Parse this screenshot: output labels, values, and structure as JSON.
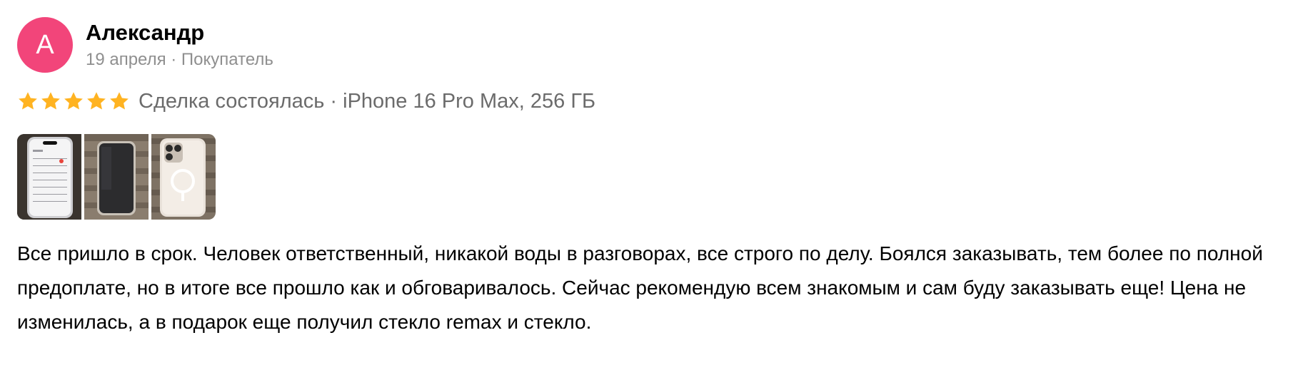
{
  "author": {
    "initial": "А",
    "name": "Александр",
    "meta": "19 апреля · Покупатель",
    "avatar_color": "#f2457a"
  },
  "rating": {
    "stars": 5,
    "star_color": "#ffb321",
    "deal_text": "Сделка состоялась · iPhone 16 Pro Max, 256 ГБ"
  },
  "photos": [
    {
      "name": "photo-phone-screen"
    },
    {
      "name": "photo-phone-back-dark"
    },
    {
      "name": "photo-phone-clear-case"
    }
  ],
  "review_text": "Все пришло в срок. Человек ответственный, никакой воды в разговорах, все строго по делу. Боялся заказывать, тем более по полной предоплате, но в итоге все прошло как и обговаривалось. Сейчас рекомендую всем знакомым и сам буду заказывать еще! Цена не изменилась, а в подарок еще получил стекло remax и стекло."
}
